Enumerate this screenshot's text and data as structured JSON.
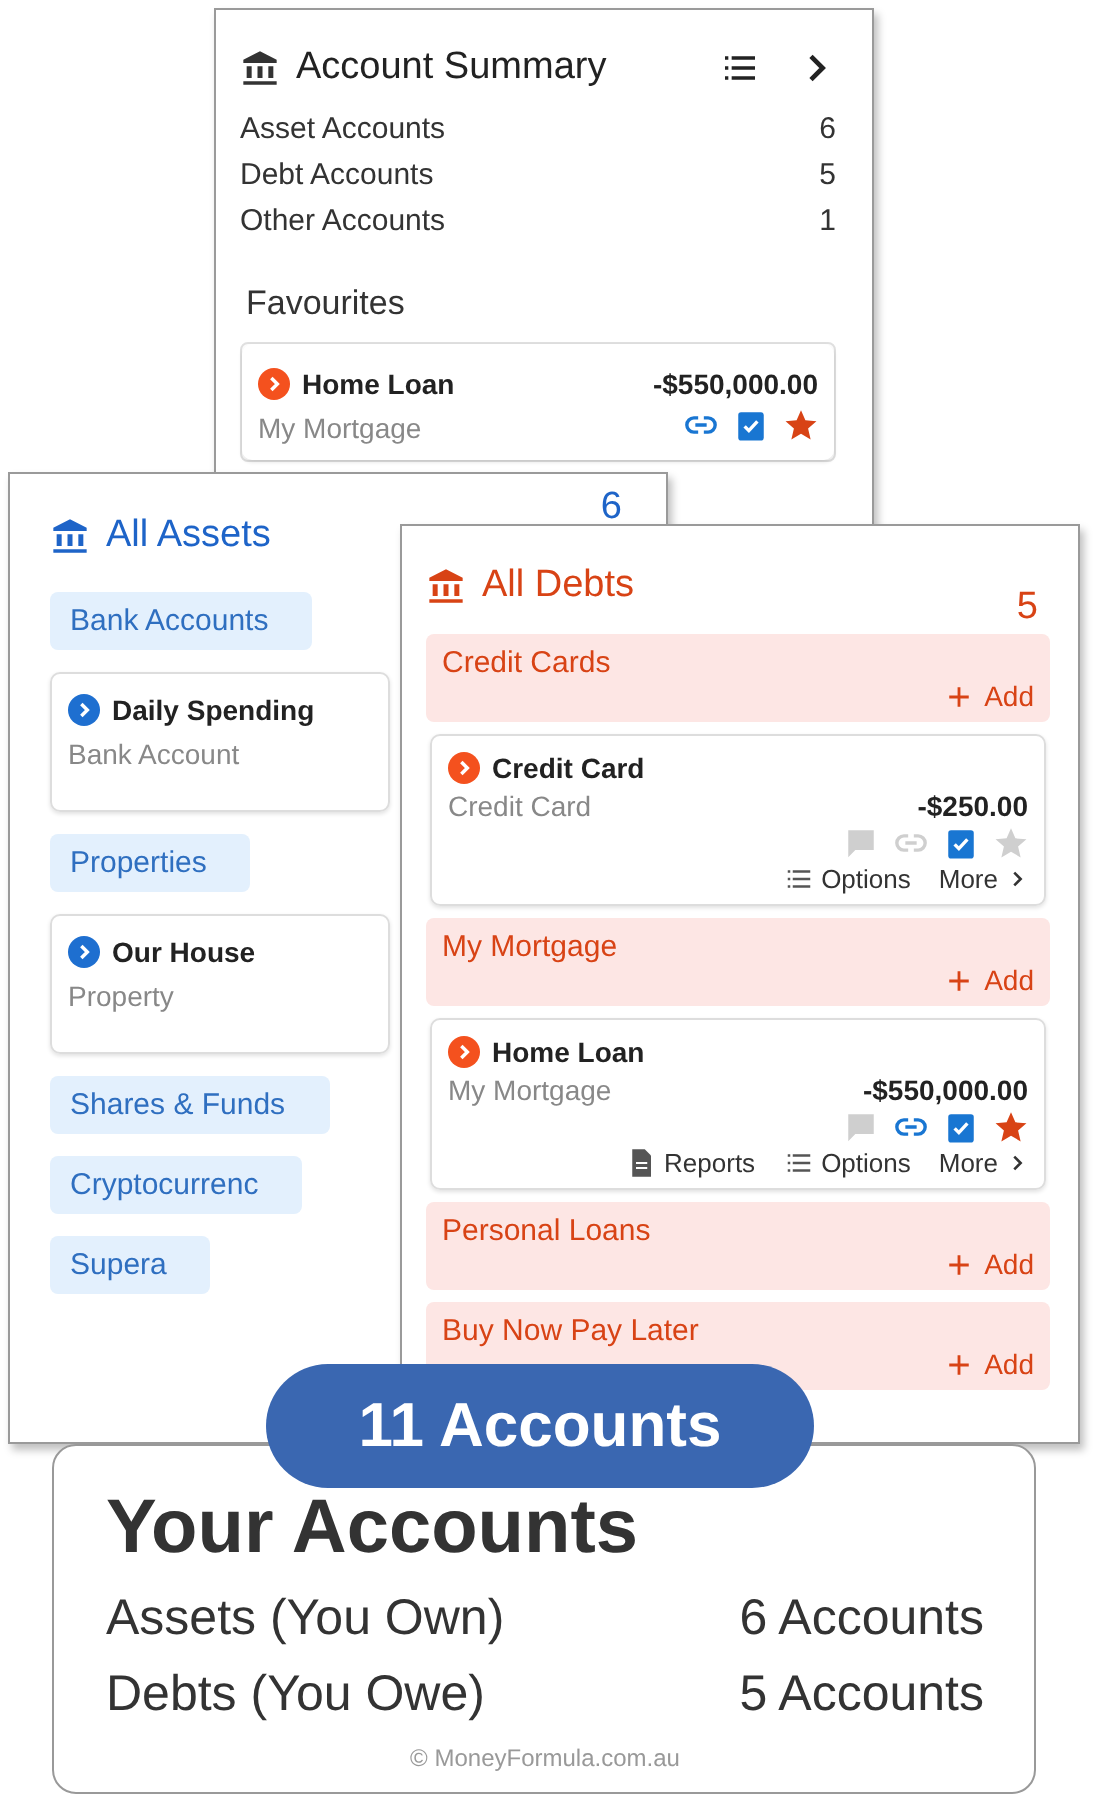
{
  "account_summary": {
    "title": "Account Summary",
    "rows": [
      {
        "label": "Asset Accounts",
        "count": "6"
      },
      {
        "label": "Debt Accounts",
        "count": "5"
      },
      {
        "label": "Other Accounts",
        "count": "1"
      }
    ],
    "favourites_heading": "Favourites",
    "favourites": [
      {
        "kind": "debt",
        "name": "Home Loan",
        "subtitle": "My Mortgage",
        "balance": "-$550,000.00",
        "linked": true,
        "reconciled": true,
        "favourite": true
      }
    ]
  },
  "all_assets": {
    "title": "All Assets",
    "count": "6",
    "groups": [
      {
        "label": "Bank Accounts",
        "accounts": [
          {
            "kind": "asset",
            "name": "Daily Spending",
            "subtitle": "Bank Account"
          }
        ]
      },
      {
        "label": "Properties",
        "accounts": [
          {
            "kind": "asset",
            "name": "Our House",
            "subtitle": "Property"
          }
        ]
      },
      {
        "label": "Shares & Funds"
      },
      {
        "label": "Cryptocurrenc"
      },
      {
        "label": "Supera"
      }
    ]
  },
  "all_debts": {
    "title": "All Debts",
    "count": "5",
    "groups": [
      {
        "label": "Credit Cards",
        "add": "Add",
        "accounts": [
          {
            "kind": "debt",
            "name": "Credit Card",
            "subtitle": "Credit Card",
            "balance": "-$250.00",
            "noted": false,
            "linked": false,
            "reconciled": true,
            "favourite": false,
            "actions": [
              {
                "kind": "options",
                "label": "Options"
              },
              {
                "kind": "more",
                "label": "More"
              }
            ]
          }
        ]
      },
      {
        "label": "My Mortgage",
        "add": "Add",
        "accounts": [
          {
            "kind": "debt",
            "name": "Home Loan",
            "subtitle": "My Mortgage",
            "balance": "-$550,000.00",
            "noted": false,
            "linked": true,
            "reconciled": true,
            "favourite": true,
            "actions": [
              {
                "kind": "reports",
                "label": "Reports"
              },
              {
                "kind": "options",
                "label": "Options"
              },
              {
                "kind": "more",
                "label": "More"
              }
            ]
          }
        ]
      },
      {
        "label": "Personal Loans",
        "add": "Add"
      },
      {
        "label": "Buy Now Pay Later",
        "add": "Add"
      }
    ]
  },
  "summary": {
    "badge": "11 Accounts",
    "title": "Your Accounts",
    "rows": [
      {
        "label": "Assets (You Own)",
        "value": "6 Accounts"
      },
      {
        "label": "Debts (You Owe)",
        "value": "5 Accounts"
      }
    ],
    "credit": "© MoneyFormula.com.au"
  }
}
